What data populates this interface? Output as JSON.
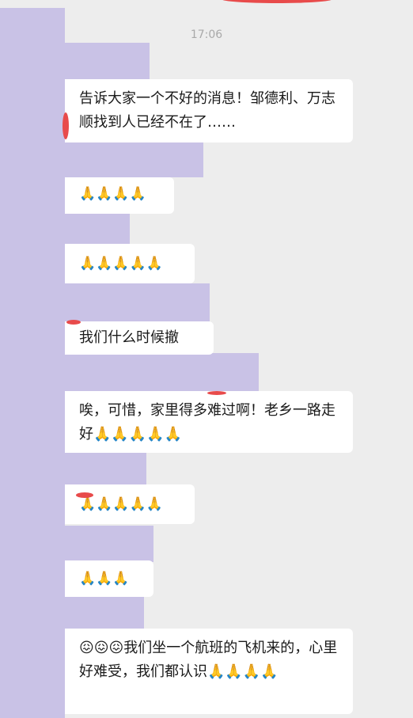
{
  "chat": {
    "timestamp": "17:06",
    "messages": [
      {
        "text": "告诉大家一个不好的消息！邹德利、万志顺找到人已经不在了……"
      },
      {
        "text": "🙏🙏🙏🙏"
      },
      {
        "text": "🙏🙏🙏🙏🙏"
      },
      {
        "text": "我们什么时候撤"
      },
      {
        "text": "唉，可惜，家里得多难过啊！老乡一路走好🙏🙏🙏🙏🙏"
      },
      {
        "text": "🙏🙏🙏🙏🙏"
      },
      {
        "text": "🙏🙏🙏"
      },
      {
        "text": "😖😖😖我们坐一个航班的飞机来的，心里好难受，我们都认识🙏🙏🙏🙏"
      }
    ]
  },
  "colors": {
    "background": "#ededed",
    "mask": "#c9c2e6",
    "bubble": "#ffffff",
    "redacted_mark": "#e84b4b",
    "timestamp_text": "#a9a9a9"
  }
}
